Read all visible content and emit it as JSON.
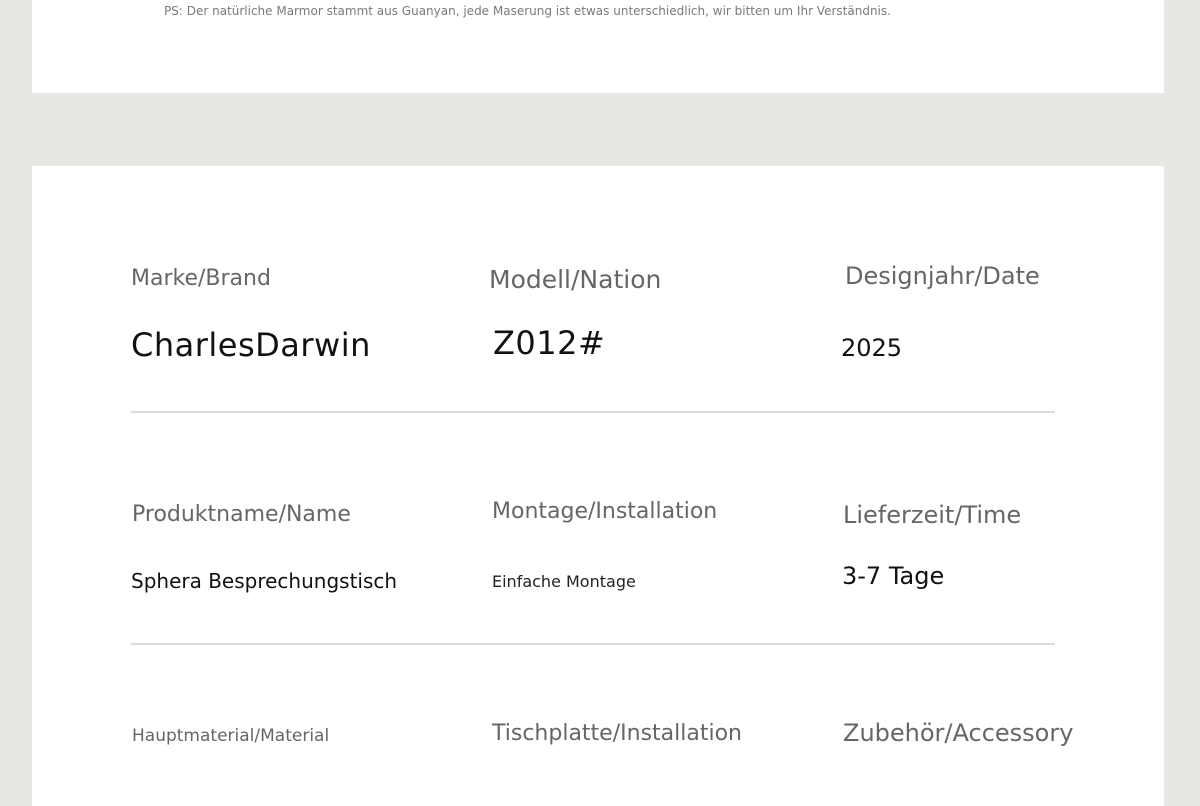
{
  "top_card": {
    "note": "PS: Der natürliche Marmor stammt aus Guanyan, jede Maserung ist etwas unterschiedlich, wir bitten um Ihr Verständnis."
  },
  "specs": {
    "brand": {
      "label": "Marke/Brand",
      "value": "CharlesDarwin"
    },
    "model": {
      "label": "Modell/Nation",
      "value": "Z012#"
    },
    "design_year": {
      "label": "Designjahr/Date",
      "value": "2025"
    },
    "product_name": {
      "label": "Produktname/Name",
      "value": "Sphera Besprechungstisch"
    },
    "assembly": {
      "label": "Montage/Installation",
      "value": "Einfache Montage"
    },
    "delivery": {
      "label": "Lieferzeit/Time",
      "value": "3-7 Tage"
    },
    "material": {
      "label": "Hauptmaterial/Material"
    },
    "tabletop": {
      "label": "Tischplatte/Installation"
    },
    "accessory": {
      "label": "Zubehör/Accessory"
    }
  }
}
